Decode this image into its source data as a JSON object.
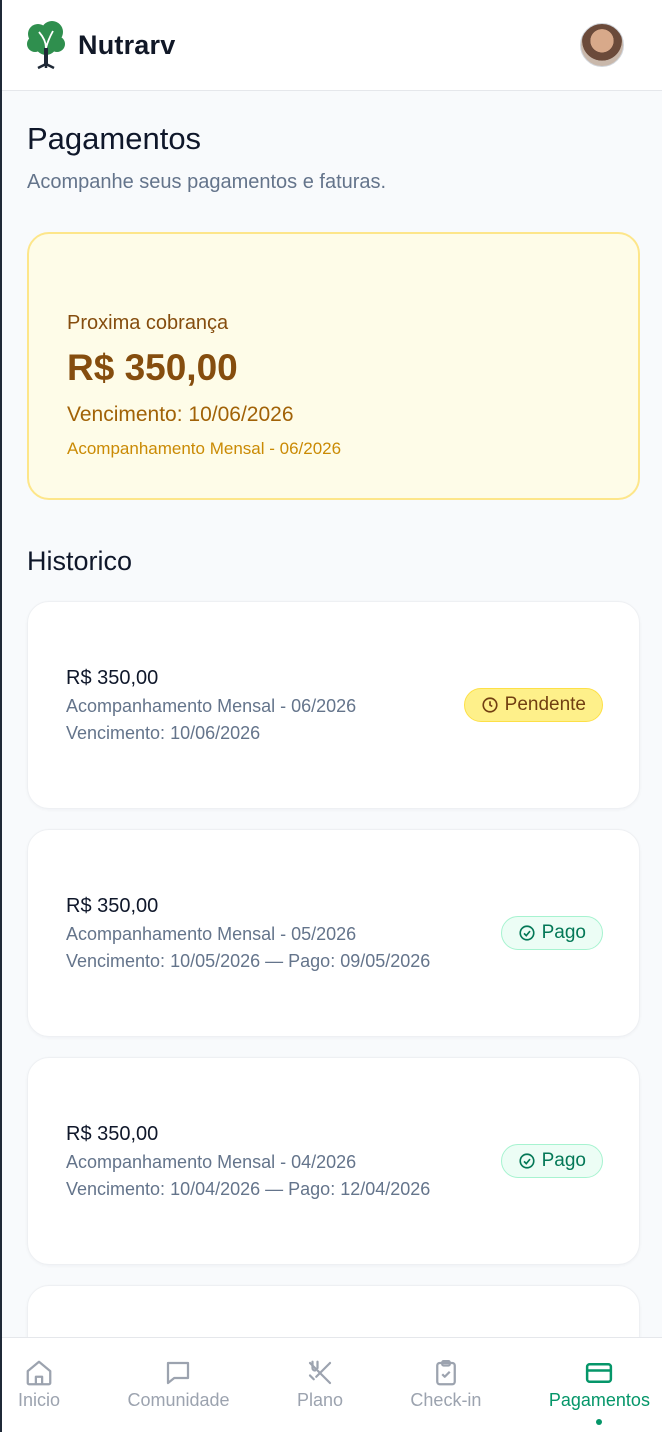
{
  "app": {
    "name": "Nutrarv",
    "logo_icon": "tree-logo-icon",
    "avatar_icon": "user-avatar"
  },
  "page": {
    "title": "Pagamentos",
    "subtitle": "Acompanhe seus pagamentos e faturas."
  },
  "next_charge": {
    "label": "Proxima cobrança",
    "amount": "R$ 350,00",
    "due": "Vencimento: 10/06/2026",
    "description": "Acompanhamento Mensal - 06/2026"
  },
  "history": {
    "title": "Historico",
    "items": [
      {
        "amount": "R$ 350,00",
        "description": "Acompanhamento Mensal - 06/2026",
        "due": "Vencimento: 10/06/2026",
        "status": "Pendente",
        "status_icon": "clock-icon"
      },
      {
        "amount": "R$ 350,00",
        "description": "Acompanhamento Mensal - 05/2026",
        "due": "Vencimento: 10/05/2026 — Pago: 09/05/2026",
        "status": "Pago",
        "status_icon": "check-circle-icon"
      },
      {
        "amount": "R$ 350,00",
        "description": "Acompanhamento Mensal - 04/2026",
        "due": "Vencimento: 10/04/2026 — Pago: 12/04/2026",
        "status": "Pago",
        "status_icon": "check-circle-icon"
      }
    ]
  },
  "nav": {
    "items": [
      {
        "label": "Inicio",
        "icon": "home-icon"
      },
      {
        "label": "Comunidade",
        "icon": "chat-icon"
      },
      {
        "label": "Plano",
        "icon": "utensils-icon"
      },
      {
        "label": "Check-in",
        "icon": "clipboard-check-icon"
      },
      {
        "label": "Pagamentos",
        "icon": "credit-card-icon",
        "active": true
      }
    ]
  },
  "colors": {
    "accent": "#059669",
    "pending_bg": "#fef08a",
    "next_card_bg": "#fefce8"
  }
}
